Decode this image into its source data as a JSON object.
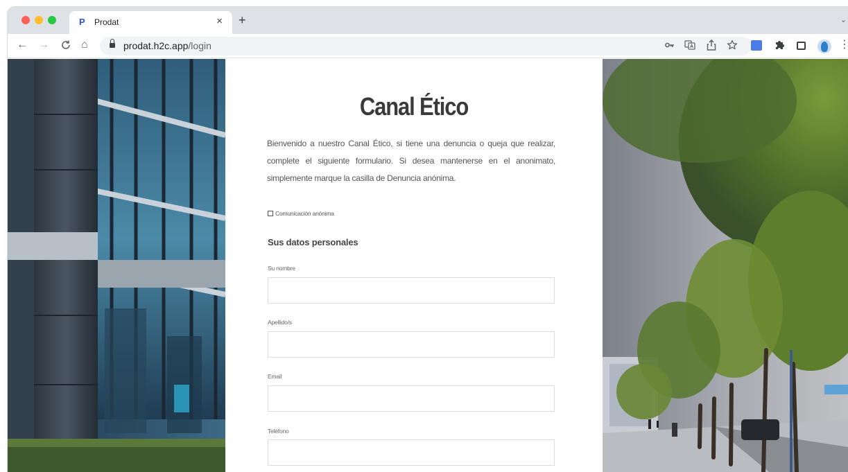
{
  "browser": {
    "tab": {
      "favicon": "P",
      "title": "Prodat",
      "close": "×"
    },
    "new_tab": "+",
    "tab_menu": "⌄",
    "nav": {
      "back": "←",
      "forward": "→",
      "reload": "C",
      "home": "⌂"
    },
    "url": {
      "domain": "prodat.h2c.app",
      "path": "/login"
    },
    "toolbar_icons": [
      "key-icon",
      "translate-icon",
      "share-icon",
      "star-icon",
      "google-translate-icon",
      "puzzle-icon",
      "side-panel-icon",
      "profile-avatar",
      "more-icon"
    ]
  },
  "page": {
    "title": "Canal Ético",
    "intro": "Bienvenido a nuestro Canal Ético, si tiene una denuncia o queja que realizar, complete el siguiente formulario. Si desea mantenerse en el anonimato, simplemente marque la casilla de Denuncia anónima.",
    "anonymous_checkbox": {
      "label": "Comunicación anónima",
      "checked": false
    },
    "section_heading": "Sus datos personales",
    "fields": [
      {
        "label": "Su nombre",
        "value": "",
        "placeholder": ""
      },
      {
        "label": "Apellido/s",
        "value": "",
        "placeholder": ""
      },
      {
        "label": "Email",
        "value": "",
        "placeholder": ""
      },
      {
        "label": "Teléfono",
        "value": "",
        "placeholder": ""
      }
    ]
  },
  "colors": {
    "title": "#3a3a3a",
    "body_text": "#555555",
    "input_border": "#dcdcdc",
    "tabstrip": "#dee1e6"
  }
}
